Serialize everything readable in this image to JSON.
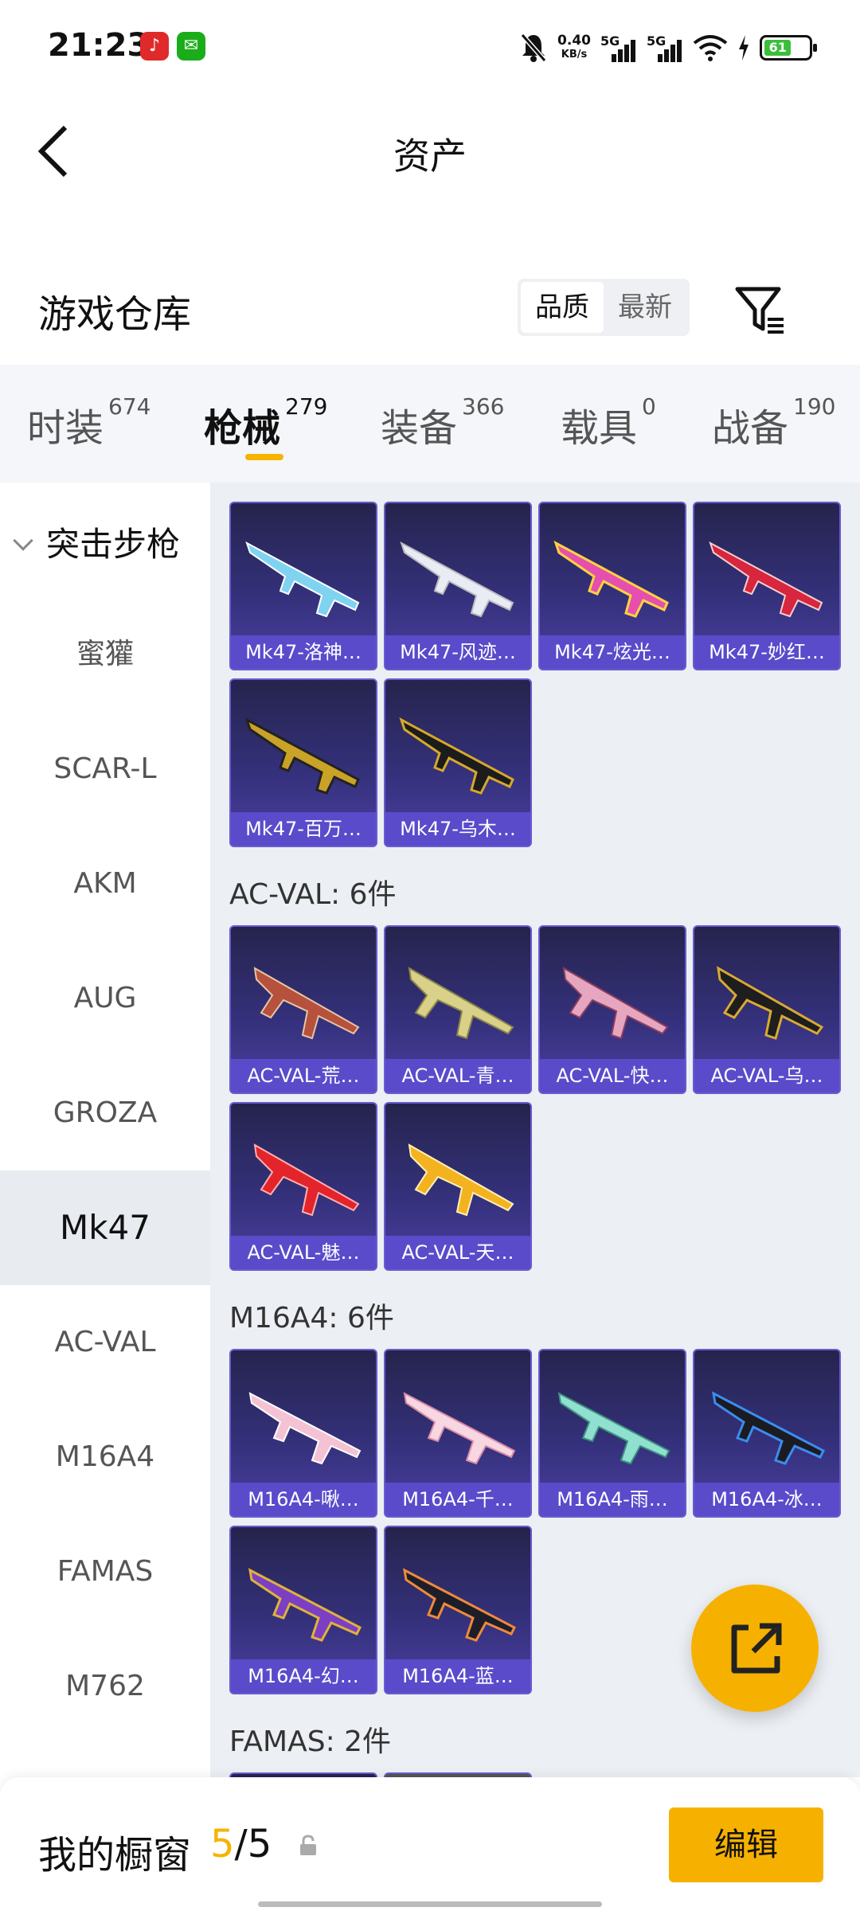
{
  "status_bar": {
    "time": "21:23",
    "net_speed_value": "0.40",
    "net_speed_unit": "KB/s",
    "signal1": "5G",
    "signal2": "5G",
    "battery": "61",
    "icons": [
      "netease-music-icon",
      "wechat-icon",
      "mute-icon",
      "wifi-icon",
      "charging-icon"
    ]
  },
  "header": {
    "title": "资产"
  },
  "warehouse": {
    "title": "游戏仓库",
    "sort_options": [
      "品质",
      "最新"
    ],
    "sort_selected": "品质"
  },
  "tabs": [
    {
      "label": "时装",
      "count": "674"
    },
    {
      "label": "枪械",
      "count": "279",
      "active": true
    },
    {
      "label": "装备",
      "count": "366"
    },
    {
      "label": "载具",
      "count": "0"
    },
    {
      "label": "战备",
      "count": "190"
    }
  ],
  "sidebar": {
    "group": "突击步枪",
    "items": [
      "蜜獾",
      "SCAR-L",
      "AKM",
      "AUG",
      "GROZA",
      "Mk47",
      "AC-VAL",
      "M16A4",
      "FAMAS",
      "M762"
    ],
    "active": "Mk47"
  },
  "sections": {
    "mk47": {
      "items": [
        "Mk47-洛神…",
        "Mk47-风迹…",
        "Mk47-炫光…",
        "Mk47-妙红…",
        "Mk47-百万…",
        "Mk47-乌木…"
      ]
    },
    "acval": {
      "title": "AC-VAL: 6件",
      "items": [
        "AC-VAL-荒…",
        "AC-VAL-青…",
        "AC-VAL-快…",
        "AC-VAL-乌…",
        "AC-VAL-魅…",
        "AC-VAL-天…"
      ]
    },
    "m16a4": {
      "title": "M16A4: 6件",
      "items": [
        "M16A4-啾…",
        "M16A4-千…",
        "M16A4-雨…",
        "M16A4-冰…",
        "M16A4-幻…",
        "M16A4-蓝…"
      ]
    },
    "famas": {
      "title": "FAMAS: 2件"
    }
  },
  "bottom_bar": {
    "label": "我的橱窗",
    "current": "5",
    "separator": "/",
    "total": "5",
    "edit_label": "编辑"
  },
  "colors": {
    "accent": "#f6b100",
    "card_bg": "#34307a",
    "card_label": "#5a4bcb"
  }
}
